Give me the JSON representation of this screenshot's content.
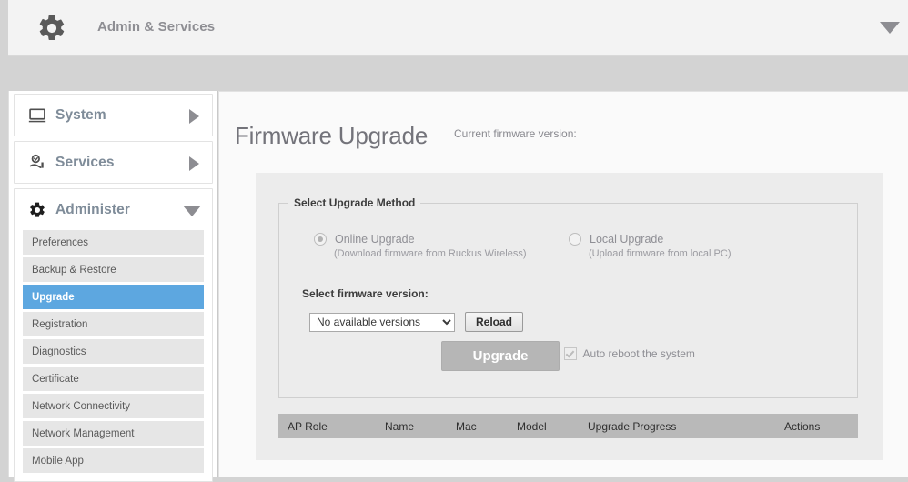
{
  "topbar": {
    "title": "Admin & Services",
    "gear_icon": "gear-icon",
    "caret_icon": "caret-down-icon"
  },
  "sidebar": {
    "groups": [
      {
        "label": "System",
        "icon": "monitor-icon",
        "expanded": false,
        "arrow": "arrow-right-icon",
        "items": []
      },
      {
        "label": "Services",
        "icon": "services-hand-icon",
        "expanded": false,
        "arrow": "arrow-right-icon",
        "items": []
      },
      {
        "label": "Administer",
        "icon": "gear-icon",
        "expanded": true,
        "arrow": "arrow-down-icon",
        "items": [
          {
            "label": "Preferences",
            "active": false
          },
          {
            "label": "Backup & Restore",
            "active": false
          },
          {
            "label": "Upgrade",
            "active": true
          },
          {
            "label": "Registration",
            "active": false
          },
          {
            "label": "Diagnostics",
            "active": false
          },
          {
            "label": "Certificate",
            "active": false
          },
          {
            "label": "Network Connectivity",
            "active": false
          },
          {
            "label": "Network Management",
            "active": false
          },
          {
            "label": "Mobile App",
            "active": false
          }
        ]
      }
    ]
  },
  "main": {
    "page_title": "Firmware Upgrade",
    "current_firmware_label": "Current firmware version:",
    "current_firmware_value": "",
    "fieldset": {
      "legend": "Select Upgrade Method",
      "options": [
        {
          "id": "online",
          "label": "Online Upgrade",
          "sublabel": "(Download firmware from Ruckus Wireless)",
          "selected": true
        },
        {
          "id": "local",
          "label": "Local Upgrade",
          "sublabel": "(Upload firmware from local PC)",
          "selected": false
        }
      ],
      "select_version_label": "Select firmware version:",
      "version_select": {
        "value": "No available versions",
        "options": [
          "No available versions"
        ]
      },
      "reload_button": "Reload",
      "upgrade_button": "Upgrade",
      "auto_reboot": {
        "label": "Auto reboot the system",
        "checked": true
      }
    },
    "table": {
      "columns": [
        "AP Role",
        "Name",
        "Mac",
        "Model",
        "Upgrade Progress",
        "Actions"
      ],
      "rows": []
    }
  },
  "colors": {
    "accent": "#5da7e0",
    "topbar_bg": "#f3f3f3",
    "panel_bg": "#ececec",
    "table_header_bg": "#b9b9b9",
    "muted_text": "#8e8e93"
  }
}
